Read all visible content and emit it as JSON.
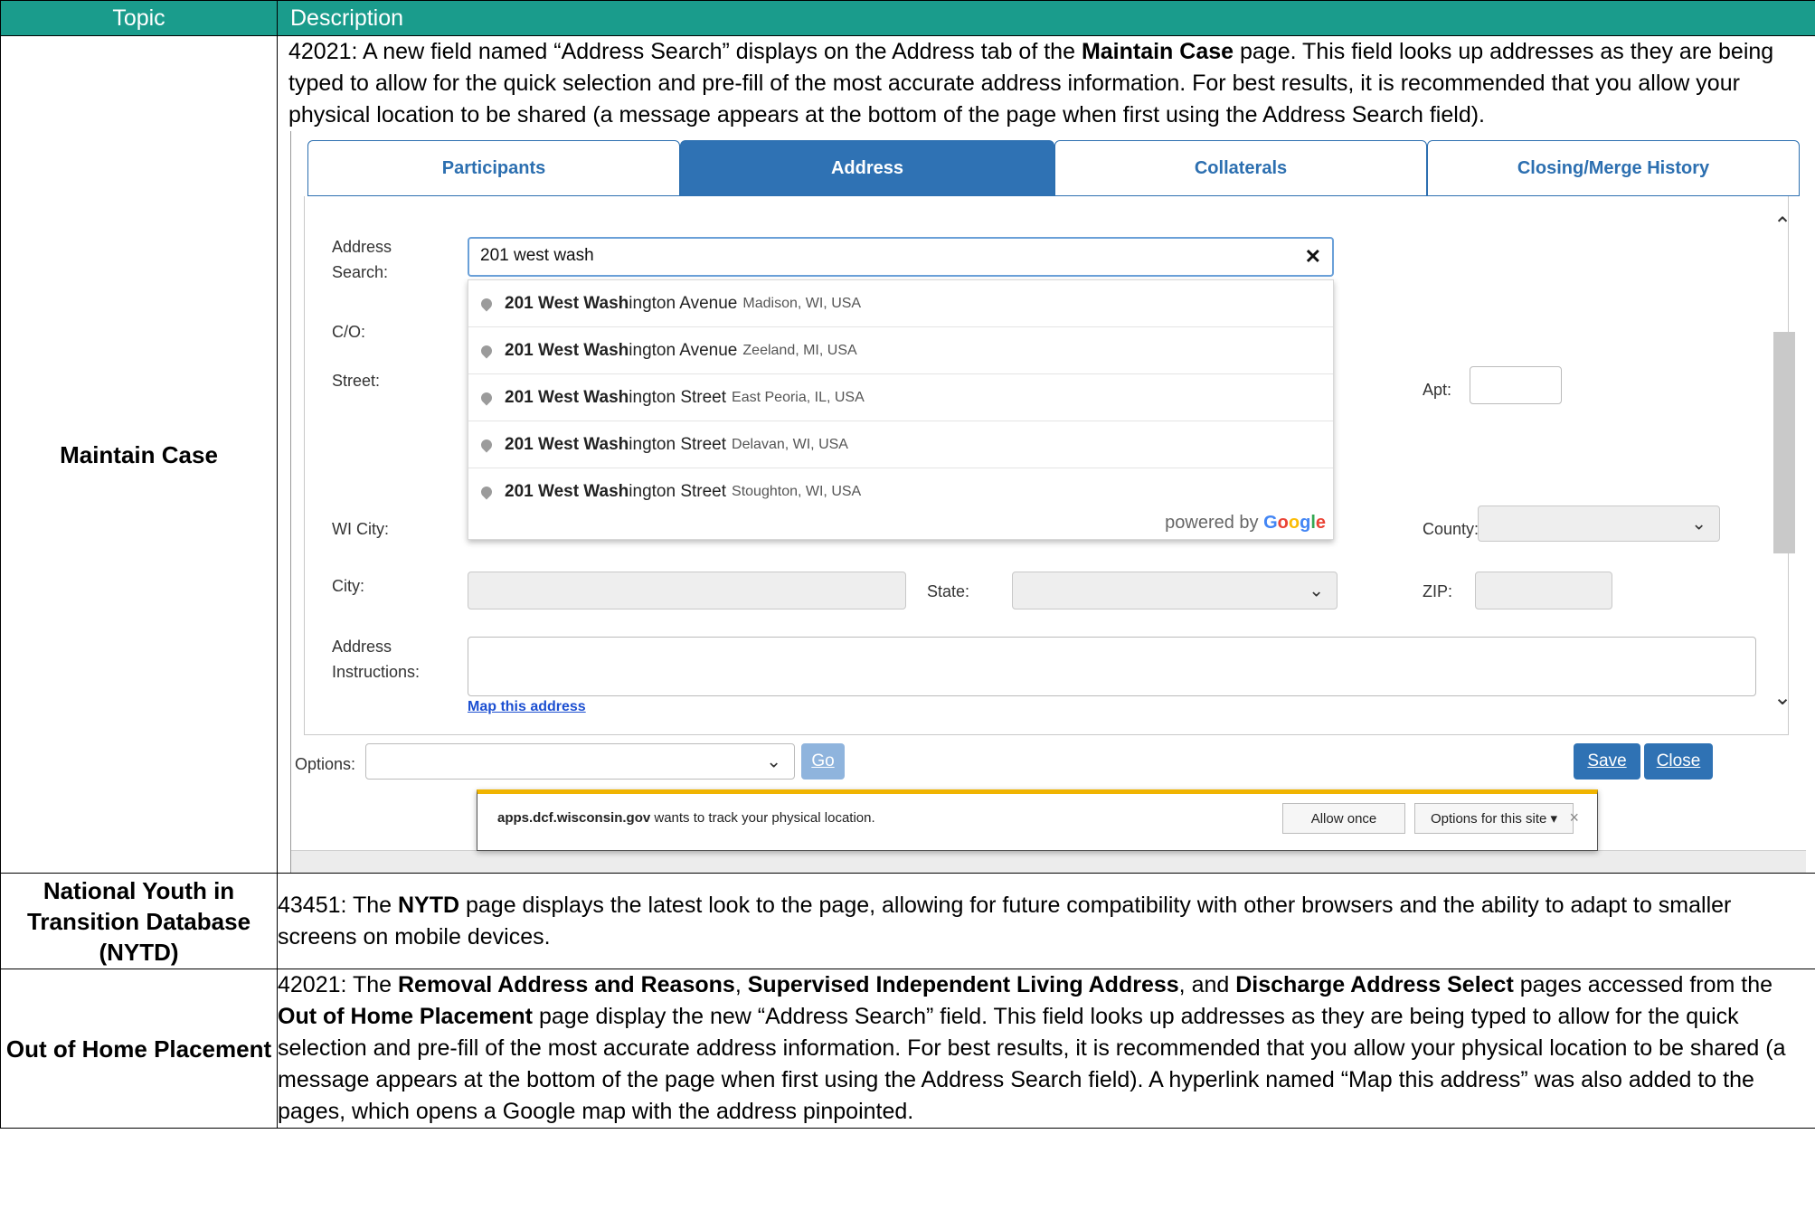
{
  "header": {
    "topic": "Topic",
    "description": "Description"
  },
  "rows": [
    {
      "topic": "Maintain Case",
      "description_parts": {
        "a": "42021: A new field named “Address Search” displays on the Address tab of the ",
        "b": "Maintain Case",
        "c": " page. This field looks up addresses as they are being typed to allow for the quick selection and pre-fill of the most accurate address information. For best results, it is recommended that you allow your physical location to be shared (a message appears at the bottom of the page when first using the Address Search field)."
      }
    },
    {
      "topic": "National Youth in Transition Database (NYTD)",
      "description_parts": {
        "a": "43451: The ",
        "b": "NYTD",
        "c": " page displays the latest look to the page, allowing for future compatibility with other browsers and the ability to adapt to smaller screens on mobile devices."
      }
    },
    {
      "topic": "Out of Home Placement",
      "description_parts": {
        "a": "42021: The ",
        "b": "Removal Address and Reasons",
        "c": ", ",
        "d": "Supervised Independent Living Address",
        "e": ", and ",
        "f": "Discharge Address Select",
        "g": " pages accessed from the ",
        "h": "Out of Home Placement",
        "i": " page display the new “Address Search” field. This field looks up addresses as they are being typed to allow for the quick selection and pre-fill of the most accurate address information. For best results, it is recommended that you allow your physical location to be shared (a message appears at the bottom of the page when first using the Address Search field). A hyperlink named “Map this address” was also added to the pages, which opens a Google map with the address pinpointed."
      }
    }
  ],
  "screenshot": {
    "tabs": [
      "Participants",
      "Address",
      "Collaterals",
      "Closing/Merge History"
    ],
    "labels": {
      "address_search_1": "Address",
      "address_search_2": "Search:",
      "co": "C/O:",
      "street": "Street:",
      "apt": "Apt:",
      "wi_city": "WI City:",
      "county": "County:",
      "city": "City:",
      "state": "State:",
      "zip": "ZIP:",
      "instructions_1": "Address",
      "instructions_2": "Instructions:",
      "options": "Options:"
    },
    "search_value": "201 west wash",
    "suggestions": [
      {
        "match": "201 West Wash",
        "rest": "ington Avenue",
        "secondary": "Madison, WI, USA"
      },
      {
        "match": "201 West Wash",
        "rest": "ington Avenue",
        "secondary": "Zeeland, MI, USA"
      },
      {
        "match": "201 West Wash",
        "rest": "ington Street",
        "secondary": "East Peoria, IL, USA"
      },
      {
        "match": "201 West Wash",
        "rest": "ington Street",
        "secondary": "Delavan, WI, USA"
      },
      {
        "match": "201 West Wash",
        "rest": "ington Street",
        "secondary": "Stoughton, WI, USA"
      }
    ],
    "powered_by": "powered by",
    "google": [
      "G",
      "o",
      "o",
      "g",
      "l",
      "e"
    ],
    "map_link": "Map this address",
    "go_button": "Go",
    "save_button": "Save",
    "close_button": "Close",
    "notification": {
      "site": "apps.dcf.wisconsin.gov",
      "message": " wants to track your physical location.",
      "allow": "Allow once",
      "options": "Options for this site ▾",
      "close": "×"
    },
    "colors": {
      "header_teal": "#1a9c8c",
      "tab_blue": "#2f72b4",
      "notif_bar": "#f0b400"
    }
  }
}
